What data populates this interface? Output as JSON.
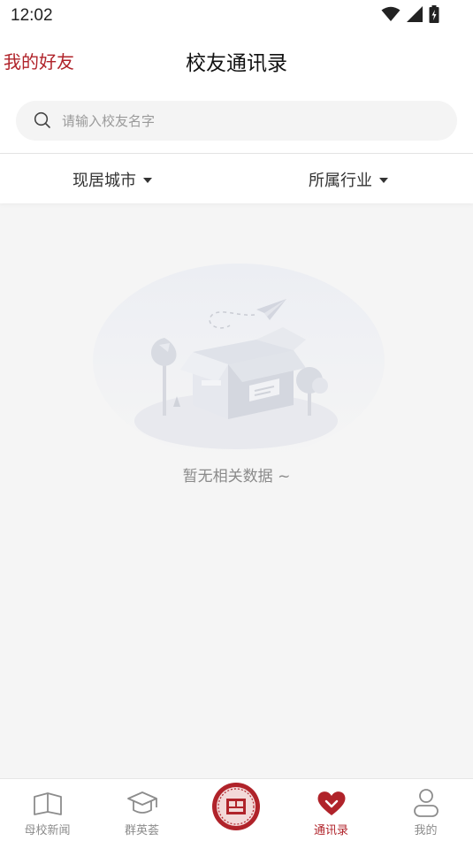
{
  "status": {
    "time": "12:02"
  },
  "nav": {
    "left_link": "我的好友",
    "title": "校友通讯录"
  },
  "search": {
    "placeholder": "请输入校友名字",
    "value": ""
  },
  "filters": {
    "city": "现居城市",
    "industry": "所属行业"
  },
  "empty": {
    "text": "暂无相关数据 ~"
  },
  "tabs": [
    {
      "label": "母校新闻",
      "icon": "book-icon",
      "active": false
    },
    {
      "label": "群英荟",
      "icon": "graduation-cap-icon",
      "active": false
    },
    {
      "label": "",
      "icon": "university-seal-icon",
      "active": false
    },
    {
      "label": "通讯录",
      "icon": "heart-icon",
      "active": true
    },
    {
      "label": "我的",
      "icon": "user-icon",
      "active": false
    }
  ],
  "colors": {
    "accent": "#b0232a",
    "inactive": "#8c8c8c",
    "background": "#f5f5f5"
  }
}
